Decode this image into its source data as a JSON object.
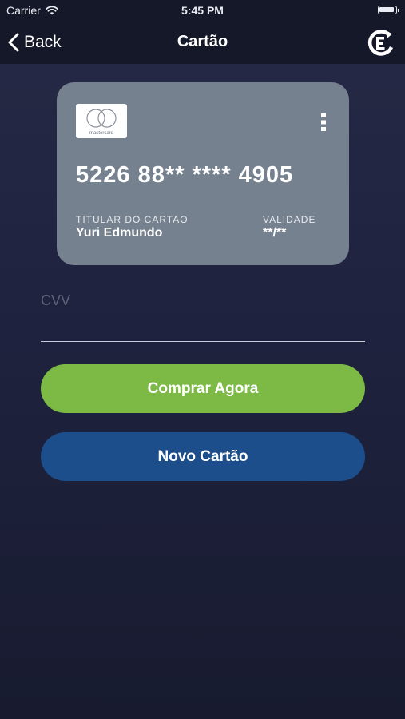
{
  "status_bar": {
    "carrier": "Carrier",
    "time": "5:45 PM",
    "battery_level": 1.0
  },
  "nav": {
    "back_label": "Back",
    "title": "Cartão"
  },
  "card": {
    "brand_logo_text": "mastercard",
    "number": "5226 88** **** 4905",
    "holder_label": "TITULAR DO CARTAO",
    "holder_name": "Yuri Edmundo",
    "validity_label": "VALIDADE",
    "validity_value": "**/**",
    "color": "#75818f"
  },
  "cvv": {
    "placeholder": "CVV",
    "value": ""
  },
  "buttons": {
    "buy_label": "Comprar Agora",
    "new_card_label": "Novo Cartão"
  },
  "colors": {
    "background": "#1f2340",
    "nav_background": "#151829",
    "buy_button": "#7cb945",
    "new_card_button": "#1c4e8c"
  },
  "icons": {
    "wifi": "wifi-icon",
    "battery": "battery-icon",
    "back": "chevron-left-icon",
    "logo": "brand-logo-icon",
    "menu": "more-vertical-icon",
    "card_brand": "mastercard-icon"
  }
}
